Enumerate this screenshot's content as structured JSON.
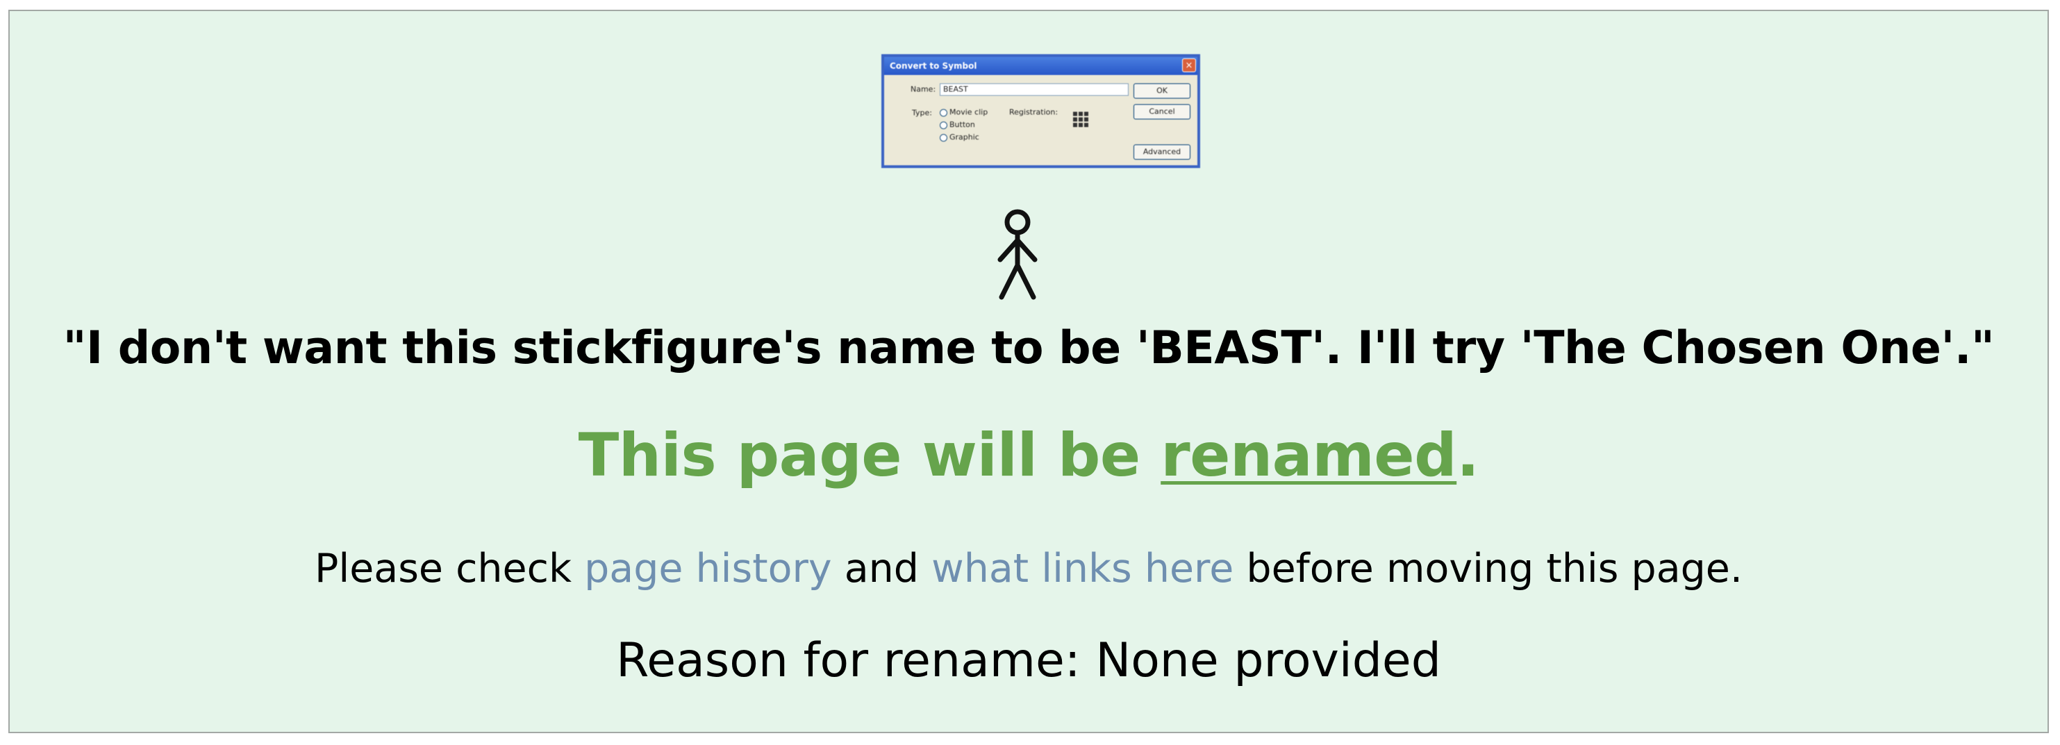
{
  "dialog": {
    "title": "Convert to Symbol",
    "close_glyph": "×",
    "name_label": "Name:",
    "name_value": "BEAST",
    "type_label": "Type:",
    "type_options": [
      "Movie clip",
      "Button",
      "Graphic"
    ],
    "registration_label": "Registration:",
    "ok_label": "OK",
    "cancel_label": "Cancel",
    "advanced_label": "Advanced"
  },
  "quote": "\"I don't want this stickfigure's name to be 'BEAST'. I'll try 'The Chosen One'.\"",
  "headline": {
    "prefix": "This page will be ",
    "link": "renamed",
    "suffix": "."
  },
  "instructions": {
    "part1": "Please check ",
    "link1": "page history",
    "part2": " and ",
    "link2": "what links here",
    "part3": " before moving this page."
  },
  "reason": "Reason for rename: None provided",
  "colors": {
    "box_background": "#e5f5ea",
    "box_border": "#a3a8a5",
    "headline_green": "#66a44c",
    "link_blue": "#6f8fb0"
  }
}
